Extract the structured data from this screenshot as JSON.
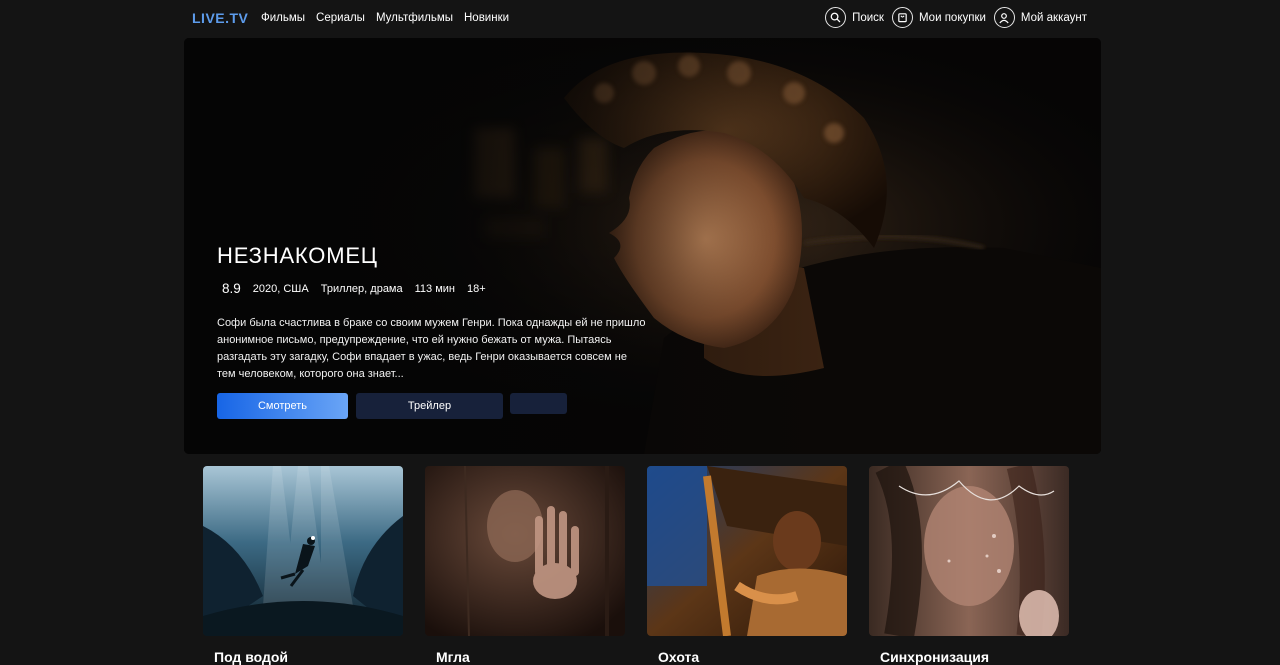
{
  "brand": {
    "logo": "LIVE.TV",
    "accent": "#5d9cec"
  },
  "nav": [
    {
      "label": "Фильмы"
    },
    {
      "label": "Сериалы"
    },
    {
      "label": "Мультфильмы"
    },
    {
      "label": "Новинки"
    }
  ],
  "actions": {
    "search": {
      "label": "Поиск",
      "icon": "search-icon"
    },
    "purchases": {
      "label": "Мои покупки",
      "icon": "bag-icon"
    },
    "account": {
      "label": "Мой аккаунт",
      "icon": "user-icon"
    }
  },
  "hero": {
    "title": "НЕЗНАКОМЕЦ",
    "rating": "8.9",
    "year_country": "2020, США",
    "genres": "Триллер, драма",
    "duration": "113 мин",
    "age": "18+",
    "description": "Софи была счастлива в браке со своим мужем Генри. Пока однажды ей не пришло анонимное письмо, предупреждение, что ей нужно бежать от мужа. Пытаясь разгадать эту загадку, Софи впадает в ужас, ведь Генри оказывается совсем не тем человеком, которого она знает...",
    "watch_label": "Смотреть",
    "trailer_label": "Трейлер"
  },
  "cards": [
    {
      "title": "Под водой"
    },
    {
      "title": "Мгла"
    },
    {
      "title": "Охота"
    },
    {
      "title": "Синхронизация"
    }
  ]
}
